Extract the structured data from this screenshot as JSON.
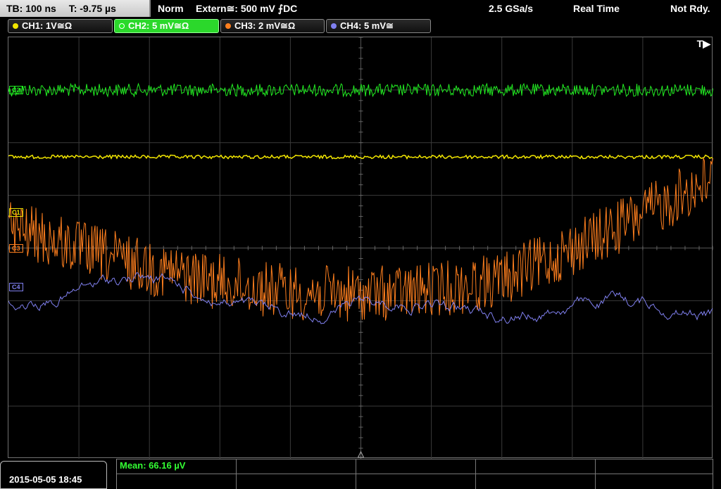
{
  "topbar": {
    "timebase": "TB: 100 ns",
    "trigger_time": "T: -9.75 µs",
    "mode": "Norm",
    "trigger_source": "Extern≅: 500 mV ⨍DC",
    "sample_rate": "2.5 GSa/s",
    "acq_mode": "Real Time",
    "status": "Not Rdy."
  },
  "channels": [
    {
      "label": "CH1: 1V≅Ω",
      "color": "#f2e600"
    },
    {
      "label": "CH2: 5 mV≅Ω",
      "color": "#22ee22"
    },
    {
      "label": "CH3: 2 mV≅Ω",
      "color": "#ff7f1e"
    },
    {
      "label": "CH4: 5 mV≅",
      "color": "#8080f0"
    }
  ],
  "trigger_marker": "T▶",
  "markers": {
    "c1": "C1",
    "c3": "C3",
    "c4": "C4",
    "c2": "C2"
  },
  "measurement": {
    "mean": "Mean: 66.16 µV"
  },
  "datetime": "2015-05-05 18:45"
}
